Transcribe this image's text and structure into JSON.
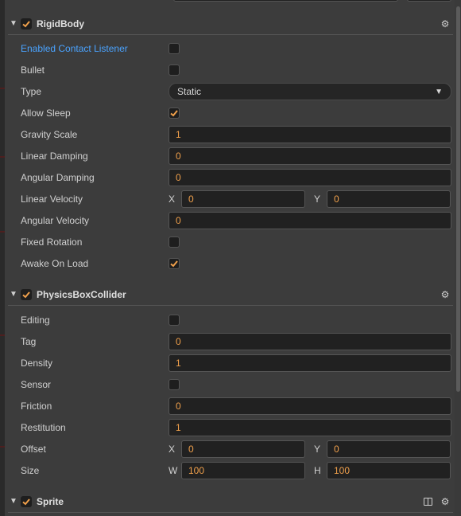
{
  "rigidbody": {
    "title": "RigidBody",
    "rows": [
      {
        "label": "Enabled Contact Listener",
        "type": "checkbox",
        "checked": false
      },
      {
        "label": "Bullet",
        "type": "checkbox",
        "checked": false
      },
      {
        "label": "Type",
        "type": "select",
        "value": "Static"
      },
      {
        "label": "Allow Sleep",
        "type": "checkbox",
        "checked": true
      },
      {
        "label": "Gravity Scale",
        "type": "input",
        "value": "1"
      },
      {
        "label": "Linear Damping",
        "type": "input",
        "value": "0"
      },
      {
        "label": "Angular Damping",
        "type": "input",
        "value": "0"
      },
      {
        "label": "Linear Velocity",
        "type": "pair",
        "a_label": "X",
        "a_value": "0",
        "b_label": "Y",
        "b_value": "0"
      },
      {
        "label": "Angular Velocity",
        "type": "input",
        "value": "0"
      },
      {
        "label": "Fixed Rotation",
        "type": "checkbox",
        "checked": false
      },
      {
        "label": "Awake On Load",
        "type": "checkbox",
        "checked": true
      }
    ]
  },
  "collider": {
    "title": "PhysicsBoxCollider",
    "rows": [
      {
        "label": "Editing",
        "type": "checkbox",
        "checked": false
      },
      {
        "label": "Tag",
        "type": "input",
        "value": "0"
      },
      {
        "label": "Density",
        "type": "input",
        "value": "1"
      },
      {
        "label": "Sensor",
        "type": "checkbox",
        "checked": false
      },
      {
        "label": "Friction",
        "type": "input",
        "value": "0"
      },
      {
        "label": "Restitution",
        "type": "input",
        "value": "1"
      },
      {
        "label": "Offset",
        "type": "pair",
        "a_label": "X",
        "a_value": "0",
        "b_label": "Y",
        "b_value": "0"
      },
      {
        "label": "Size",
        "type": "pair",
        "a_label": "W",
        "a_value": "100",
        "b_label": "H",
        "b_value": "100"
      }
    ]
  },
  "sprite": {
    "title": "Sprite"
  },
  "colors": {
    "accent_check": "#f0a04b",
    "value_text": "#f0a04b",
    "link_label": "#4aa3ff"
  },
  "icons": {
    "caret": "caret-down-icon",
    "settings": "gear-icon",
    "help": "book-icon",
    "checked": "checkmark-icon"
  }
}
